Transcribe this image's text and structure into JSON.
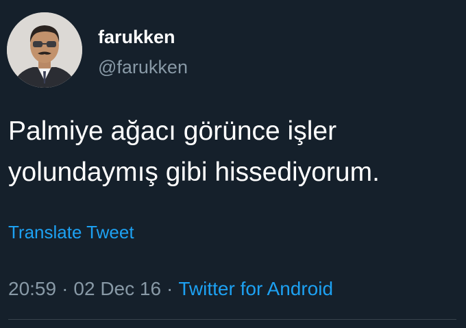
{
  "tweet": {
    "display_name": "farukken",
    "handle": "@farukken",
    "text_lines": [
      "Palmiye ağacı görünce işler",
      "yolundaymış gibi hissediyorum."
    ],
    "translate_label": "Translate Tweet",
    "time": "20:59",
    "separator": "·",
    "date": "02 Dec 16",
    "source": "Twitter for Android"
  },
  "colors": {
    "background": "#15202b",
    "text": "#ffffff",
    "secondary_text": "#8899a6",
    "accent": "#1da1f2",
    "divider": "#38444d"
  }
}
